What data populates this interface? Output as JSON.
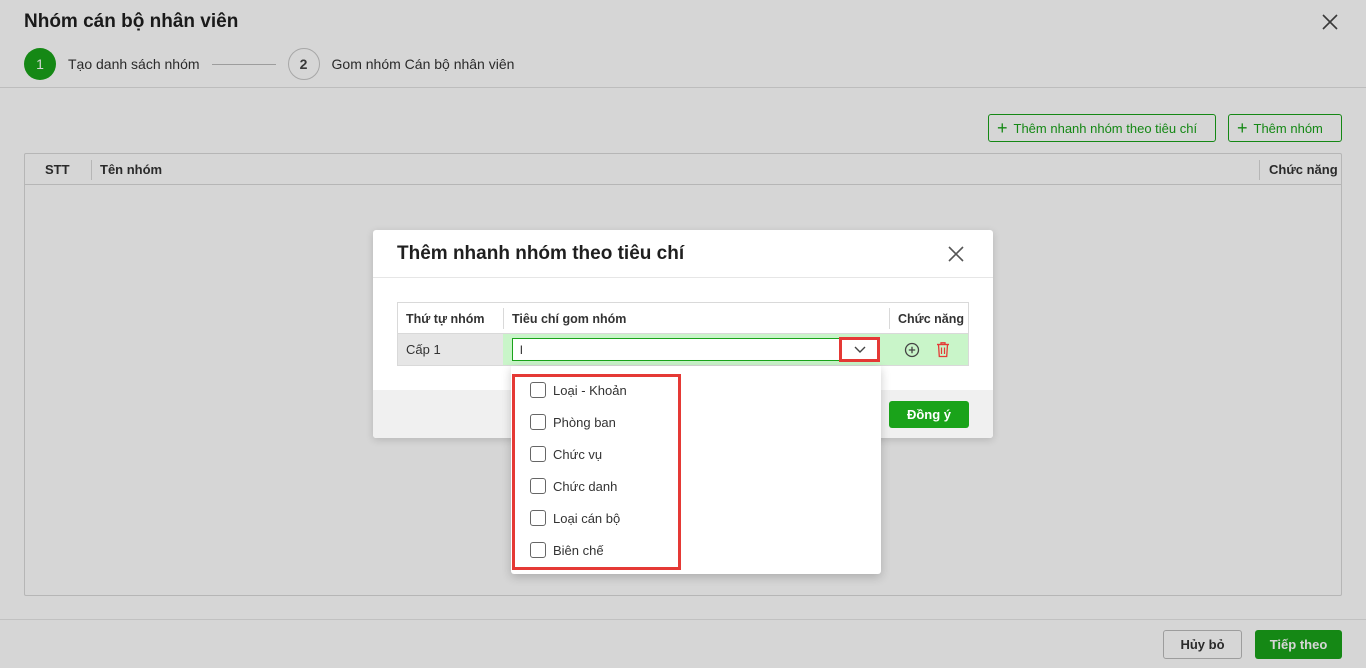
{
  "page": {
    "title": "Nhóm cán bộ nhân viên",
    "steps": [
      {
        "number": "1",
        "label": "Tạo danh sách nhóm"
      },
      {
        "number": "2",
        "label": "Gom nhóm Cán bộ nhân viên"
      }
    ],
    "toolbar": {
      "quick_add_label": "Thêm nhanh nhóm theo tiêu chí",
      "add_group_label": "Thêm nhóm"
    },
    "grid_columns": {
      "stt": "STT",
      "name": "Tên nhóm",
      "function": "Chức năng"
    },
    "footer": {
      "cancel_label": "Hủy bỏ",
      "next_label": "Tiếp theo"
    }
  },
  "modal": {
    "title": "Thêm nhanh nhóm theo tiêu chí",
    "columns": {
      "order": "Thứ tự nhóm",
      "criteria": "Tiêu chí gom nhóm",
      "function": "Chức năng"
    },
    "row": {
      "order": "Cấp 1",
      "criteria_value": "l"
    },
    "agree_label": "Đồng ý"
  },
  "dropdown": {
    "options": [
      {
        "label": "Loại - Khoản",
        "checked": false
      },
      {
        "label": "Phòng ban",
        "checked": false
      },
      {
        "label": "Chức vụ",
        "checked": false
      },
      {
        "label": "Chức danh",
        "checked": false
      },
      {
        "label": "Loại cán bộ",
        "checked": false
      },
      {
        "label": "Biên chế",
        "checked": false
      }
    ]
  },
  "colors": {
    "accent": "#1aa31a",
    "highlight": "#e53935",
    "row_highlight": "#c9f5c9"
  },
  "icons": [
    "close-icon",
    "plus-icon",
    "chevron-down-icon",
    "plus-circle-icon",
    "trash-icon",
    "checkbox-icon"
  ]
}
